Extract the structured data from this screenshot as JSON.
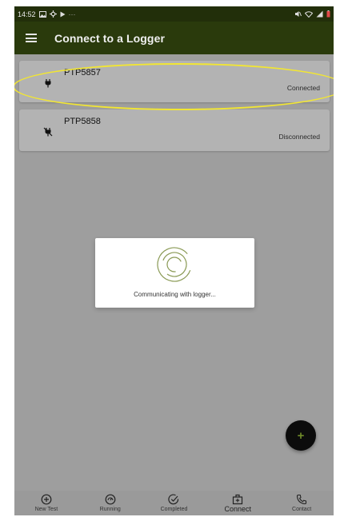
{
  "status_bar": {
    "time": "14:52",
    "left_icons": [
      "image-icon",
      "settings-icon",
      "play-icon",
      "more-icon"
    ],
    "right_icons": [
      "mute-icon",
      "wifi-icon",
      "signal-icon",
      "battery-icon"
    ]
  },
  "app_bar": {
    "menu_icon": "menu-icon",
    "title": "Connect to a Logger"
  },
  "loggers": [
    {
      "name": "PTP5857",
      "status": "Connected",
      "icon": "plug-icon",
      "highlighted": true
    },
    {
      "name": "PTP5858",
      "status": "Disconnected",
      "icon": "plug-disconnected-icon",
      "highlighted": false
    }
  ],
  "dialog": {
    "message": "Communicating with logger...",
    "icon": "spinner-icon"
  },
  "fab": {
    "label": "+",
    "icon": "plus-icon"
  },
  "bottom_nav": [
    {
      "label": "New Test",
      "icon": "add-circle-icon",
      "active": false
    },
    {
      "label": "Running",
      "icon": "gauge-icon",
      "active": false
    },
    {
      "label": "Completed",
      "icon": "check-circle-icon",
      "active": false
    },
    {
      "label": "Connect",
      "icon": "connect-icon",
      "active": true
    },
    {
      "label": "Contact",
      "icon": "phone-icon",
      "active": false
    }
  ],
  "colors": {
    "app_bar": "#2a3a0c",
    "status_bar": "#222f0a",
    "overlay_background": "#9e9e9e",
    "card": "#b3b3b3",
    "highlight": "#f2e632",
    "accent": "#6f8a2a",
    "fab": "#0c0c0c"
  }
}
